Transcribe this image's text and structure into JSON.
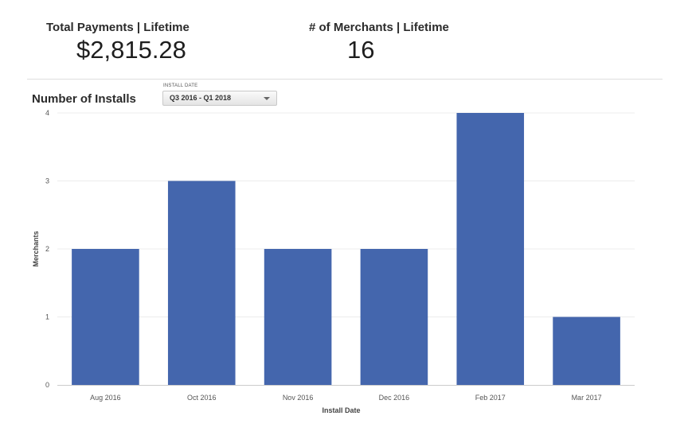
{
  "kpis": {
    "payments": {
      "title": "Total Payments | Lifetime",
      "value": "$2,815.28"
    },
    "merchants": {
      "title": "# of Merchants | Lifetime",
      "value": "16"
    }
  },
  "section": {
    "title": "Number of Installs"
  },
  "filter": {
    "label": "INSTALL DATE",
    "value": "Q3 2016 - Q1 2018",
    "icon": "chevron-down-icon"
  },
  "chart_data": {
    "type": "bar",
    "categories": [
      "Aug 2016",
      "Oct 2016",
      "Nov 2016",
      "Dec 2016",
      "Feb 2017",
      "Mar 2017"
    ],
    "values": [
      2,
      3,
      2,
      2,
      4,
      1
    ],
    "xlabel": "Install Date",
    "ylabel": "Merchants",
    "ylim": [
      0,
      4
    ],
    "yticks": [
      0,
      1,
      2,
      3,
      4
    ],
    "grid": true,
    "legend": "none",
    "bar_color": "#4466ad",
    "grid_color": "#ececec",
    "axis_color": "#cccccc"
  }
}
